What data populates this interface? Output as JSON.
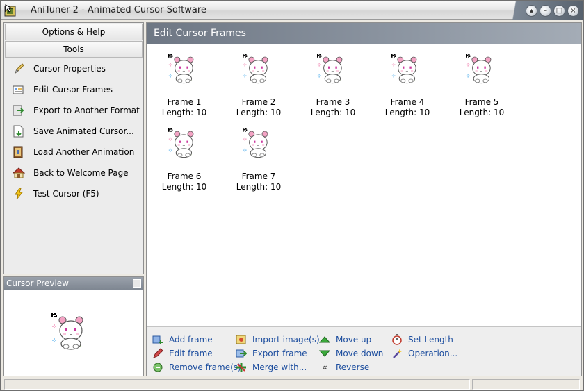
{
  "window": {
    "title": "AniTuner 2 - Animated Cursor Software",
    "controls": [
      "minimize-to-tray",
      "minimize",
      "maximize",
      "close"
    ]
  },
  "sidebar": {
    "tabs": [
      "Options & Help",
      "Tools"
    ],
    "items": [
      {
        "label": "Cursor Properties",
        "icon": "pencil-icon"
      },
      {
        "label": "Edit Cursor Frames",
        "icon": "frames-icon"
      },
      {
        "label": "Export to Another Format",
        "icon": "export-icon"
      },
      {
        "label": "Save Animated Cursor...",
        "icon": "save-icon"
      },
      {
        "label": "Load Another Animation",
        "icon": "load-icon"
      },
      {
        "label": "Back to Welcome Page",
        "icon": "home-icon"
      },
      {
        "label": "Test Cursor (F5)",
        "icon": "lightning-icon"
      }
    ]
  },
  "preview": {
    "title": "Cursor Preview"
  },
  "main": {
    "title": "Edit Cursor Frames",
    "frames": [
      {
        "name": "Frame 1",
        "length": "Length: 10"
      },
      {
        "name": "Frame 2",
        "length": "Length: 10"
      },
      {
        "name": "Frame 3",
        "length": "Length: 10"
      },
      {
        "name": "Frame 4",
        "length": "Length: 10"
      },
      {
        "name": "Frame 5",
        "length": "Length: 10"
      },
      {
        "name": "Frame 6",
        "length": "Length: 10"
      },
      {
        "name": "Frame 7",
        "length": "Length: 10"
      }
    ]
  },
  "actions": {
    "add_frame": "Add frame",
    "edit_frame": "Edit frame",
    "remove_frames": "Remove frame(s)",
    "import_images": "Import image(s)",
    "export_frame": "Export frame",
    "merge_with": "Merge with...",
    "move_up": "Move up",
    "move_down": "Move down",
    "reverse": "Reverse",
    "set_length": "Set Length",
    "operation": "Operation..."
  },
  "colors": {
    "link": "#1c4d9e",
    "header": "#7d8590",
    "bear_pink": "#f3a3c4",
    "bear_eye": "#cc3aa0"
  }
}
